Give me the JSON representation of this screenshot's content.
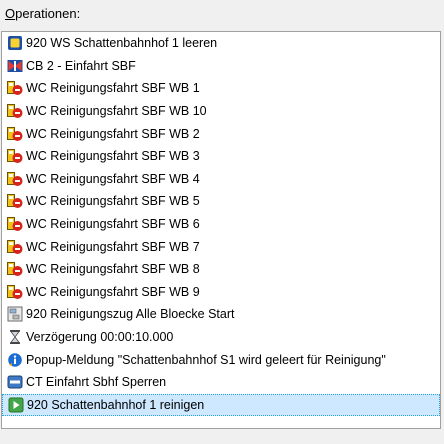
{
  "header": {
    "prefix": "O",
    "rest": "perationen:"
  },
  "operations": [
    {
      "label": "920 WS Schattenbahnhof 1 leeren",
      "icon": "block-icon"
    },
    {
      "label": "CB 2 - Einfahrt SBF",
      "icon": "route-icon"
    },
    {
      "label": "WC  Reinigungsfahrt SBF WB 1",
      "icon": "train-operation-icon"
    },
    {
      "label": "WC  Reinigungsfahrt SBF WB 10",
      "icon": "train-operation-icon"
    },
    {
      "label": "WC  Reinigungsfahrt SBF WB 2",
      "icon": "train-operation-icon"
    },
    {
      "label": "WC  Reinigungsfahrt SBF WB 3",
      "icon": "train-operation-icon"
    },
    {
      "label": "WC  Reinigungsfahrt SBF WB 4",
      "icon": "train-operation-icon"
    },
    {
      "label": "WC  Reinigungsfahrt SBF WB 5",
      "icon": "train-operation-icon"
    },
    {
      "label": "WC  Reinigungsfahrt SBF WB 6",
      "icon": "train-operation-icon"
    },
    {
      "label": "WC  Reinigungsfahrt SBF WB 7",
      "icon": "train-operation-icon"
    },
    {
      "label": "WC  Reinigungsfahrt SBF WB 8",
      "icon": "train-operation-icon"
    },
    {
      "label": "WC  Reinigungsfahrt SBF WB 9",
      "icon": "train-operation-icon"
    },
    {
      "label": "920 Reinigungszug Alle Bloecke Start",
      "icon": "macro-icon"
    },
    {
      "label": "Verzögerung 00:00:10.000",
      "icon": "hourglass-icon"
    },
    {
      "label": "Popup-Meldung \"Schattenbahnhof S1 wird geleert für Reinigung\"",
      "icon": "info-icon"
    },
    {
      "label": "CT Einfahrt Sbhf Sperren",
      "icon": "track-lock-icon"
    },
    {
      "label": "920 Schattenbahnhof 1 reinigen",
      "icon": "play-icon"
    }
  ],
  "selected_index": 16,
  "colors": {
    "selection_bg": "#cde8ff",
    "selection_border": "#26a0da",
    "list_border": "#a0a0a0",
    "window_bg": "#f0f0f0"
  }
}
